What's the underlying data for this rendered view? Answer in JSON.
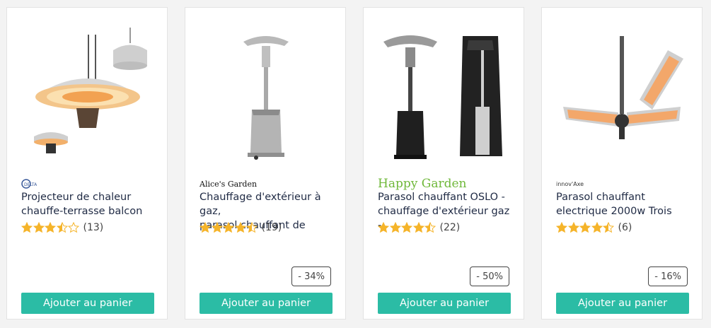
{
  "products": [
    {
      "brand": "DELTA",
      "title_line1": "Projecteur de chaleur",
      "title_line2": "chauffe-terrasse balcon",
      "rating": 3.5,
      "review_count": "(13)",
      "discount": "",
      "button_label": "Ajouter au panier",
      "image_icon": "hanging-heater-image"
    },
    {
      "brand": "Alice's Garden",
      "title_line1": "Chauffage d'extérieur à gaz,",
      "title_line2": "parasol chauffant de",
      "rating": 4.5,
      "review_count": "(19)",
      "discount": "- 34%",
      "button_label": "Ajouter au panier",
      "image_icon": "patio-heater-image"
    },
    {
      "brand": "Happy Garden",
      "title_line1": "Parasol chauffant OSLO -",
      "title_line2": "chauffage d'extérieur gaz -",
      "rating": 4.5,
      "review_count": "(22)",
      "discount": "- 50%",
      "button_label": "Ajouter au panier",
      "image_icon": "patio-heater-cover-image"
    },
    {
      "brand": "innov'Axe",
      "title_line1": "Parasol chauffant",
      "title_line2": "electrique 2000w Trois",
      "rating": 4.5,
      "review_count": "(6)",
      "discount": "- 16%",
      "button_label": "Ajouter au panier",
      "image_icon": "three-arm-heater-image"
    }
  ],
  "colors": {
    "accent": "#2bbca5",
    "star": "#f5b42a",
    "title": "#1f2a44"
  }
}
